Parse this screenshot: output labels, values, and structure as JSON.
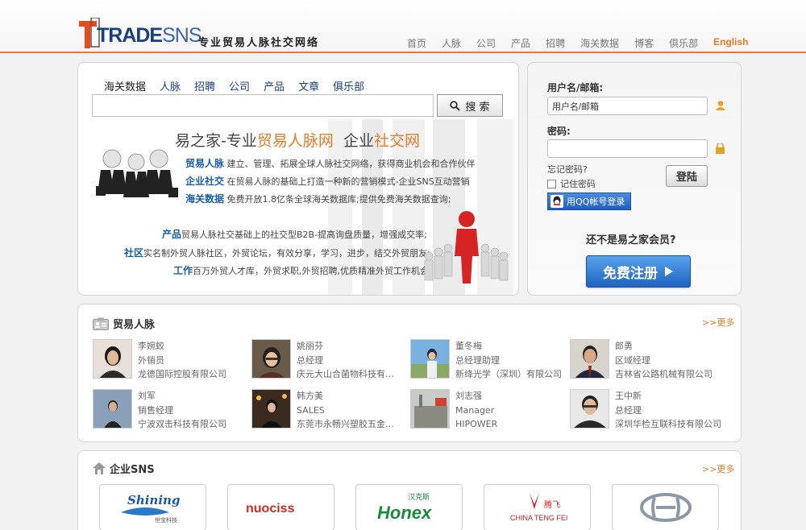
{
  "header": {
    "logo_main": "TRADE",
    "logo_sns": "SNS",
    "slogan": "专业贸易人脉社交网络",
    "nav": [
      "首页",
      "人脉",
      "公司",
      "产品",
      "招聘",
      "海关数据",
      "博客",
      "俱乐部"
    ],
    "english": "English"
  },
  "search": {
    "tabs": [
      "海关数据",
      "人脉",
      "招聘",
      "公司",
      "产品",
      "文章",
      "俱乐部"
    ],
    "input_value": "",
    "button_label": "搜 索"
  },
  "hero": {
    "headline_a": "易之家-专业",
    "headline_b": "贸易人脉网",
    "headline_c": "企业",
    "headline_d": "社交网",
    "features": [
      {
        "key": "贸易人脉",
        "text": "建立、管理、拓展全球人脉社交网络，获得商业机会和合作伙伴"
      },
      {
        "key": "企业社交",
        "text": "在贸易人脉的基础上打造一种新的营销模式-企业SNS互动营销"
      },
      {
        "key": "海关数据",
        "text": "免费开放1.8亿条全球海关数据库;提供免费海关数据查询;"
      },
      {
        "key": "产品",
        "text": "贸易人脉社交基础上的社交型B2B-提高询盘质量，增强成交率;"
      },
      {
        "key": "社区",
        "text": "实名制外贸人脉社区，外贸论坛，有效分享，学习，进步，结交外贸朋友;"
      },
      {
        "key": "工作",
        "text": "百万外贸人才库，外贸求职,外贸招聘,优质精准外贸工作机会;"
      }
    ]
  },
  "login": {
    "username_label": "用户名/邮箱:",
    "username_value": "用户名/邮箱",
    "password_label": "密码:",
    "password_value": "",
    "forgot": "忘记密码?",
    "remember": "记住密码",
    "login_button": "登陆",
    "qq_button": "用QQ帐号登录",
    "not_member": "还不是易之家会员?",
    "register_button": "免费注册"
  },
  "people_section": {
    "title": "贸易人脉",
    "more": ">>更多",
    "people": [
      {
        "name": "李婉蛟",
        "title": "外销员",
        "company": "龙德国际控股有限公司"
      },
      {
        "name": "姚丽芬",
        "title": "总经理",
        "company": "庆元大山合菌物科技有…"
      },
      {
        "name": "董冬梅",
        "title": "总经理助理",
        "company": "新绛光学（深圳）有限公司"
      },
      {
        "name": "郎勇",
        "title": "区域经理",
        "company": "吉林省公路机械有限公司"
      },
      {
        "name": "刘军",
        "title": "销售经理",
        "company": "宁波双击科技有限公司"
      },
      {
        "name": "韩方美",
        "title": "SALES",
        "company": "东莞市永畅兴塑胶五金…"
      },
      {
        "name": "刘志强",
        "title": "Manager",
        "company": "HIPOWER"
      },
      {
        "name": "王中新",
        "title": "总经理",
        "company": "深圳华检互联科技有限公司"
      }
    ]
  },
  "sns_section": {
    "title": "企业SNS",
    "more": ">>更多",
    "brands": [
      "Shining",
      "世宝科技",
      "nuociss",
      "汉克斯",
      "Honex",
      "腾飞",
      "CHINA TENG FEI"
    ]
  },
  "colors": {
    "accent": "#e77b2a",
    "link": "#1a3c8c",
    "register_blue": "#1d63bf"
  }
}
